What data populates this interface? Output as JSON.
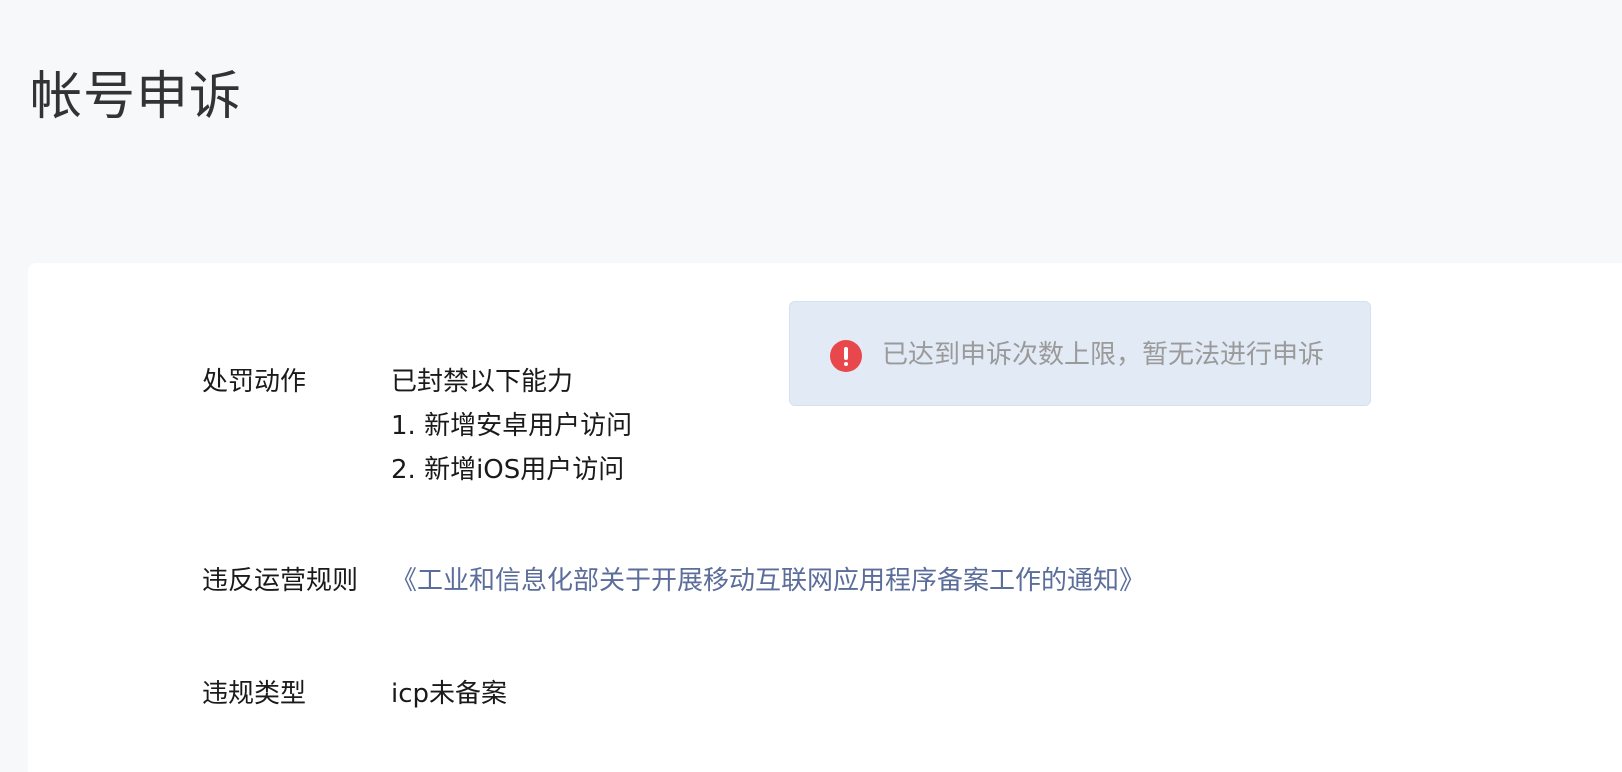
{
  "page": {
    "title": "帐号申诉"
  },
  "notice": {
    "icon": "error-icon",
    "icon_color": "#e8474b",
    "text": "已达到申诉次数上限，暂无法进行申诉"
  },
  "details": {
    "penalty": {
      "label": "处罚动作",
      "lines": [
        "已封禁以下能力",
        "1. 新增安卓用户访问",
        "2. 新增iOS用户访问"
      ]
    },
    "rule": {
      "label": "违反运营规则",
      "link_text": "《工业和信息化部关于开展移动互联网应用程序备案工作的通知》",
      "link_color": "#5b6d9a"
    },
    "violation_type": {
      "label": "违规类型",
      "value": "icp未备案"
    }
  }
}
